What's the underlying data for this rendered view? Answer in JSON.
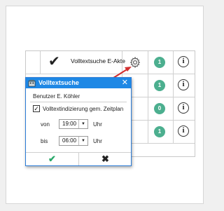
{
  "table": {
    "header_row": {
      "title": "Volltextsuche E-Akte",
      "count": "1",
      "info_icon": "info-icon"
    },
    "rows": [
      {
        "count": "1"
      },
      {
        "count": "0"
      },
      {
        "count": "1"
      }
    ]
  },
  "dialog": {
    "title": "Volltextsuche",
    "close_glyph": "✕",
    "user_line": "Benutzer E. Köhler",
    "checkbox_label": "Volltextindizierung gem. Zeitplan",
    "checkbox_checked": true,
    "from_label": "von",
    "from_time": "19:00",
    "to_label": "bis",
    "to_time": "06:00",
    "unit_label": "Uhr",
    "ok_icon": "check-icon",
    "cancel_icon": "close-icon"
  },
  "colors": {
    "accent": "#1e88e5",
    "badge": "#4caf8f",
    "annotation_arrow": "#d32f2f",
    "ok": "#29a96a"
  }
}
